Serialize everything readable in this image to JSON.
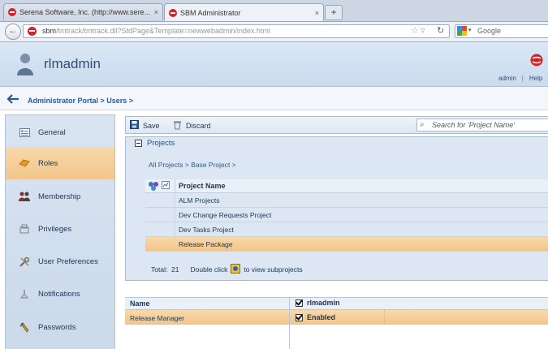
{
  "browser": {
    "tabs": [
      {
        "title": "Serena Software, Inc. (http://www.sere...",
        "active": false
      },
      {
        "title": "SBM Administrator",
        "active": true
      }
    ],
    "new_tab_label": "+",
    "url_host": "sbm",
    "url_path": "/tmtrack/tmtrack.dll?StdPage&Template=newwebadmin/index.html",
    "search_engine": "Google",
    "tab_close": "×"
  },
  "header": {
    "username": "rlmadmin",
    "links": [
      "admin",
      "Help"
    ]
  },
  "breadcrumb": "Administrator Portal > Users >",
  "sidebar": {
    "items": [
      {
        "label": "General",
        "icon": "general-icon",
        "selected": false
      },
      {
        "label": "Roles",
        "icon": "roles-icon",
        "selected": true
      },
      {
        "label": "Membership",
        "icon": "membership-icon",
        "selected": false
      },
      {
        "label": "Privileges",
        "icon": "privileges-icon",
        "selected": false
      },
      {
        "label": "User Preferences",
        "icon": "user-preferences-icon",
        "selected": false
      },
      {
        "label": "Notifications",
        "icon": "notifications-icon",
        "selected": false
      },
      {
        "label": "Passwords",
        "icon": "passwords-icon",
        "selected": false
      }
    ]
  },
  "toolbar": {
    "save_label": "Save",
    "discard_label": "Discard",
    "search_placeholder": "Search for 'Project Name'"
  },
  "projects": {
    "title": "Projects",
    "breadcrumb": "All Projects > Base Project >",
    "column": "Project Name",
    "rows": [
      {
        "name": "ALM Projects",
        "selected": false
      },
      {
        "name": "Dev Change Requests Project",
        "selected": false
      },
      {
        "name": "Dev Tasks Project",
        "selected": false
      },
      {
        "name": "Release Package",
        "selected": true
      }
    ],
    "total_label": "Total:",
    "total_value": "21",
    "hint_before": "Double click",
    "hint_after": "to view subprojects"
  },
  "roles": {
    "name_header": "Name",
    "user_header": "rlmadmin",
    "rows": [
      {
        "name": "Release Manager",
        "value": "Enabled",
        "checked": true
      }
    ]
  },
  "colors": {
    "selection": "#f2c58a",
    "header_bg": "#c9dbee",
    "link": "#2c5b93",
    "brand_red": "#d2232a"
  }
}
